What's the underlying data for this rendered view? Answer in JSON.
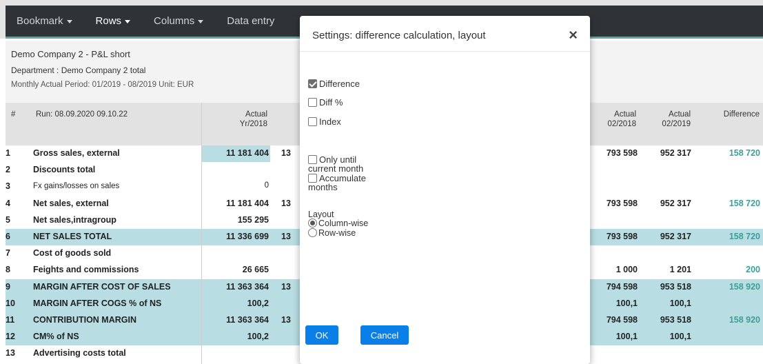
{
  "nav": {
    "items": [
      {
        "label": "Bookmark",
        "active": false
      },
      {
        "label": "Rows",
        "active": true
      },
      {
        "label": "Columns",
        "active": false
      },
      {
        "label": "Data entry",
        "active": false
      }
    ]
  },
  "report": {
    "title": "Demo Company 2 - P&L short",
    "department": "Department : Demo Company 2 total",
    "period": "Monthly Actual Period: 01/2019 - 08/2019 Unit: EUR"
  },
  "table": {
    "headers": {
      "num": "#",
      "run": "Run: 08.09.2020 09.10.22",
      "actual_yr2018": [
        "Actual",
        "Yr/2018"
      ],
      "actual_02_2018": [
        "Actual",
        "02/2018"
      ],
      "actual_02_2019": [
        "Actual",
        "02/2019"
      ],
      "difference": "Difference"
    },
    "rows": [
      {
        "num": "1",
        "label": "Gross sales, external",
        "yr": "11 181 404",
        "partial": "13",
        "a18": "793 598",
        "a19": "952 317",
        "diff": "158 720",
        "hl": false,
        "bold": true
      },
      {
        "num": "2",
        "label": "Discounts total",
        "yr": "",
        "partial": "",
        "a18": "",
        "a19": "",
        "diff": "",
        "hl": false,
        "bold": true
      },
      {
        "num": "3",
        "label": "Fx gains/losses on sales",
        "yr": "0",
        "partial": "",
        "a18": "",
        "a19": "",
        "diff": "",
        "hl": false,
        "bold": false
      },
      {
        "num": "4",
        "label": "Net sales, external",
        "yr": "11 181 404",
        "partial": "13",
        "a18": "793 598",
        "a19": "952 317",
        "diff": "158 720",
        "hl": false,
        "bold": true
      },
      {
        "num": "5",
        "label": "Net sales,intragroup",
        "yr": "155 295",
        "partial": "",
        "a18": "",
        "a19": "",
        "diff": "",
        "hl": false,
        "bold": true
      },
      {
        "num": "6",
        "label": "NET SALES TOTAL",
        "yr": "11 336 699",
        "partial": "13",
        "a18": "793 598",
        "a19": "952 317",
        "diff": "158 720",
        "hl": true,
        "bold": true
      },
      {
        "num": "7",
        "label": "Cost of goods sold",
        "yr": "",
        "partial": "",
        "a18": "",
        "a19": "",
        "diff": "",
        "hl": false,
        "bold": true
      },
      {
        "num": "8",
        "label": "Feights and commissions",
        "yr": "26 665",
        "partial": "",
        "a18": "1 000",
        "a19": "1 201",
        "diff": "200",
        "hl": false,
        "bold": true
      },
      {
        "num": "9",
        "label": "MARGIN AFTER COST OF SALES",
        "yr": "11 363 364",
        "partial": "13",
        "a18": "794 598",
        "a19": "953 518",
        "diff": "158 920",
        "hl": true,
        "bold": true
      },
      {
        "num": "10",
        "label": "MARGIN AFTER COGS % of NS",
        "yr": "100,2",
        "partial": "",
        "a18": "100,1",
        "a19": "100,1",
        "diff": "",
        "hl": true,
        "bold": true
      },
      {
        "num": "11",
        "label": "CONTRIBUTION MARGIN",
        "yr": "11 363 364",
        "partial": "13",
        "a18": "794 598",
        "a19": "953 518",
        "diff": "158 920",
        "hl": true,
        "bold": true
      },
      {
        "num": "12",
        "label": "CM% of NS",
        "yr": "100,2",
        "partial": "",
        "a18": "100,1",
        "a19": "100,1",
        "diff": "",
        "hl": true,
        "bold": true
      },
      {
        "num": "13",
        "label": "Advertising costs total",
        "yr": "",
        "partial": "",
        "a18": "",
        "a19": "",
        "diff": "",
        "hl": false,
        "bold": true
      }
    ]
  },
  "modal": {
    "title": "Settings: difference calculation, layout",
    "close": "×",
    "options": {
      "difference": {
        "label": "Difference",
        "checked": true
      },
      "diff_pct": {
        "label": "Diff %",
        "checked": false
      },
      "index": {
        "label": "Index",
        "checked": false
      },
      "only_until_1": "Only until",
      "only_until_2": "current month",
      "accumulate_1": "Accumulate",
      "accumulate_2": "months"
    },
    "layout": {
      "label": "Layout",
      "column_wise": "Column-wise",
      "row_wise": "Row-wise",
      "selected": "Column-wise"
    },
    "ok": "OK",
    "cancel": "Cancel"
  },
  "colors": {
    "nav_bg": "#2f3337",
    "accent": "#5ba7a6",
    "highlight_row": "#b8dde3",
    "diff_text": "#3a9f9b",
    "button": "#0a7fe8"
  }
}
